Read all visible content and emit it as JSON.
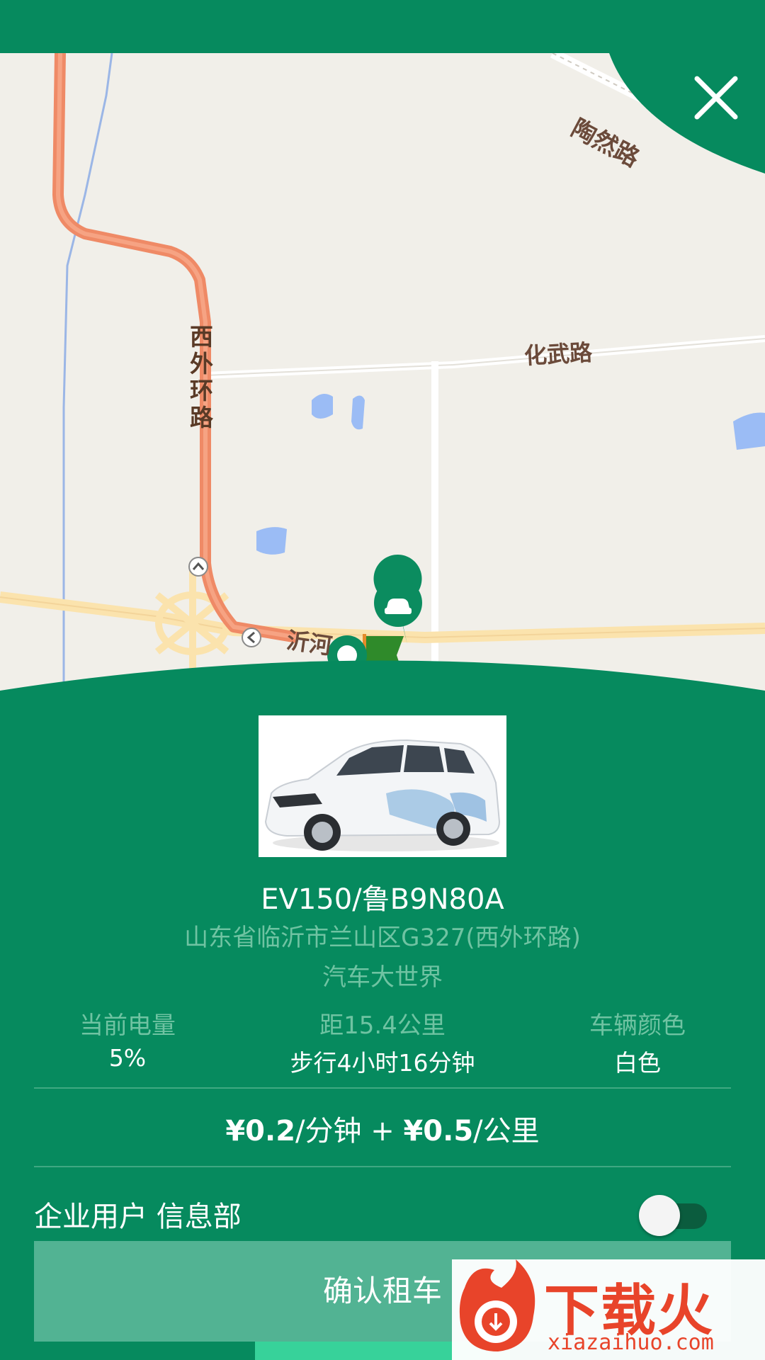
{
  "map": {
    "labels": {
      "taoran_road": "陶然路",
      "huawu_road": "化武路",
      "xiwai_ring": "西外环路",
      "yi_road": "沂河"
    },
    "icons": [
      "close-icon",
      "car-marker-icon",
      "flag-marker-icon",
      "location-marker-icon"
    ]
  },
  "car": {
    "title": "EV150/鲁B9N80A",
    "address": "山东省临沂市兰山区G327(西外环路)",
    "place": "汽车大世界"
  },
  "stats": {
    "battery_label": "当前电量",
    "battery_value": "5%",
    "distance_label": "距15.4公里",
    "distance_value": "步行4小时16分钟",
    "color_label": "车辆颜色",
    "color_value": "白色"
  },
  "price": {
    "per_minute": "¥0.2",
    "minute_unit": "/分钟 + ",
    "per_km": "¥0.5",
    "km_unit": "/公里"
  },
  "corp": {
    "label": "企业用户 信息部",
    "toggle_on": false
  },
  "confirm": {
    "label": "确认租车"
  },
  "watermark": {
    "text": "下载火",
    "url": "xiazaihuo.com"
  },
  "colors": {
    "primary": "#068a5e",
    "muted_text": "#6fc3a2",
    "button": "#52b393",
    "route": "#ef8a66",
    "map_bg": "#f1efe9"
  }
}
